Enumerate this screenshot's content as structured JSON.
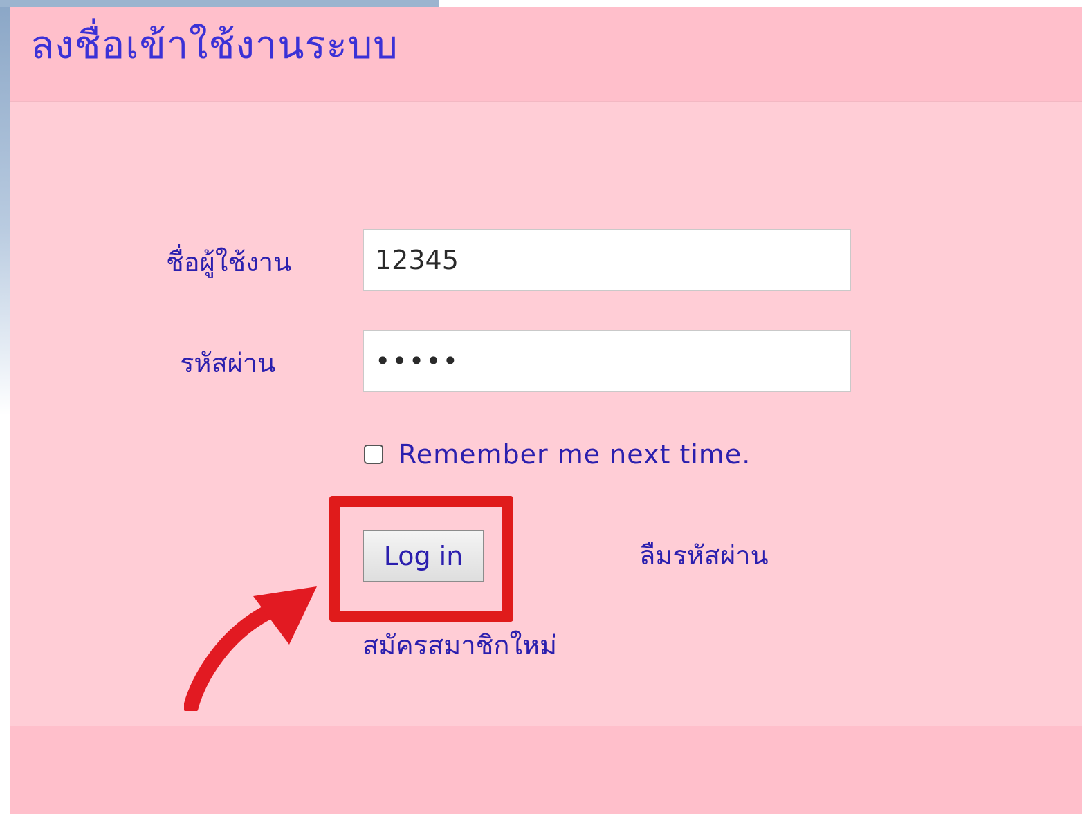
{
  "header": {
    "title": "ลงชื่อเข้าใช้งานระบบ"
  },
  "form": {
    "username_label": "ชื่อผู้ใช้งาน",
    "username_value": "12345",
    "password_label": "รหัสผ่าน",
    "password_value": "12345",
    "remember_label": "Remember me next time.",
    "remember_checked": false,
    "login_label": "Log in",
    "forgot_label": "ลืมรหัสผ่าน",
    "register_label": "สมัครสมาชิกใหม่"
  },
  "annotation": {
    "highlight_color": "#e01b1b",
    "arrow_icon": "curved-arrow-icon"
  },
  "colors": {
    "header_bg": "#ffbfcb",
    "panel_bg": "#ffcdd6",
    "text_color": "#2b1fae"
  }
}
